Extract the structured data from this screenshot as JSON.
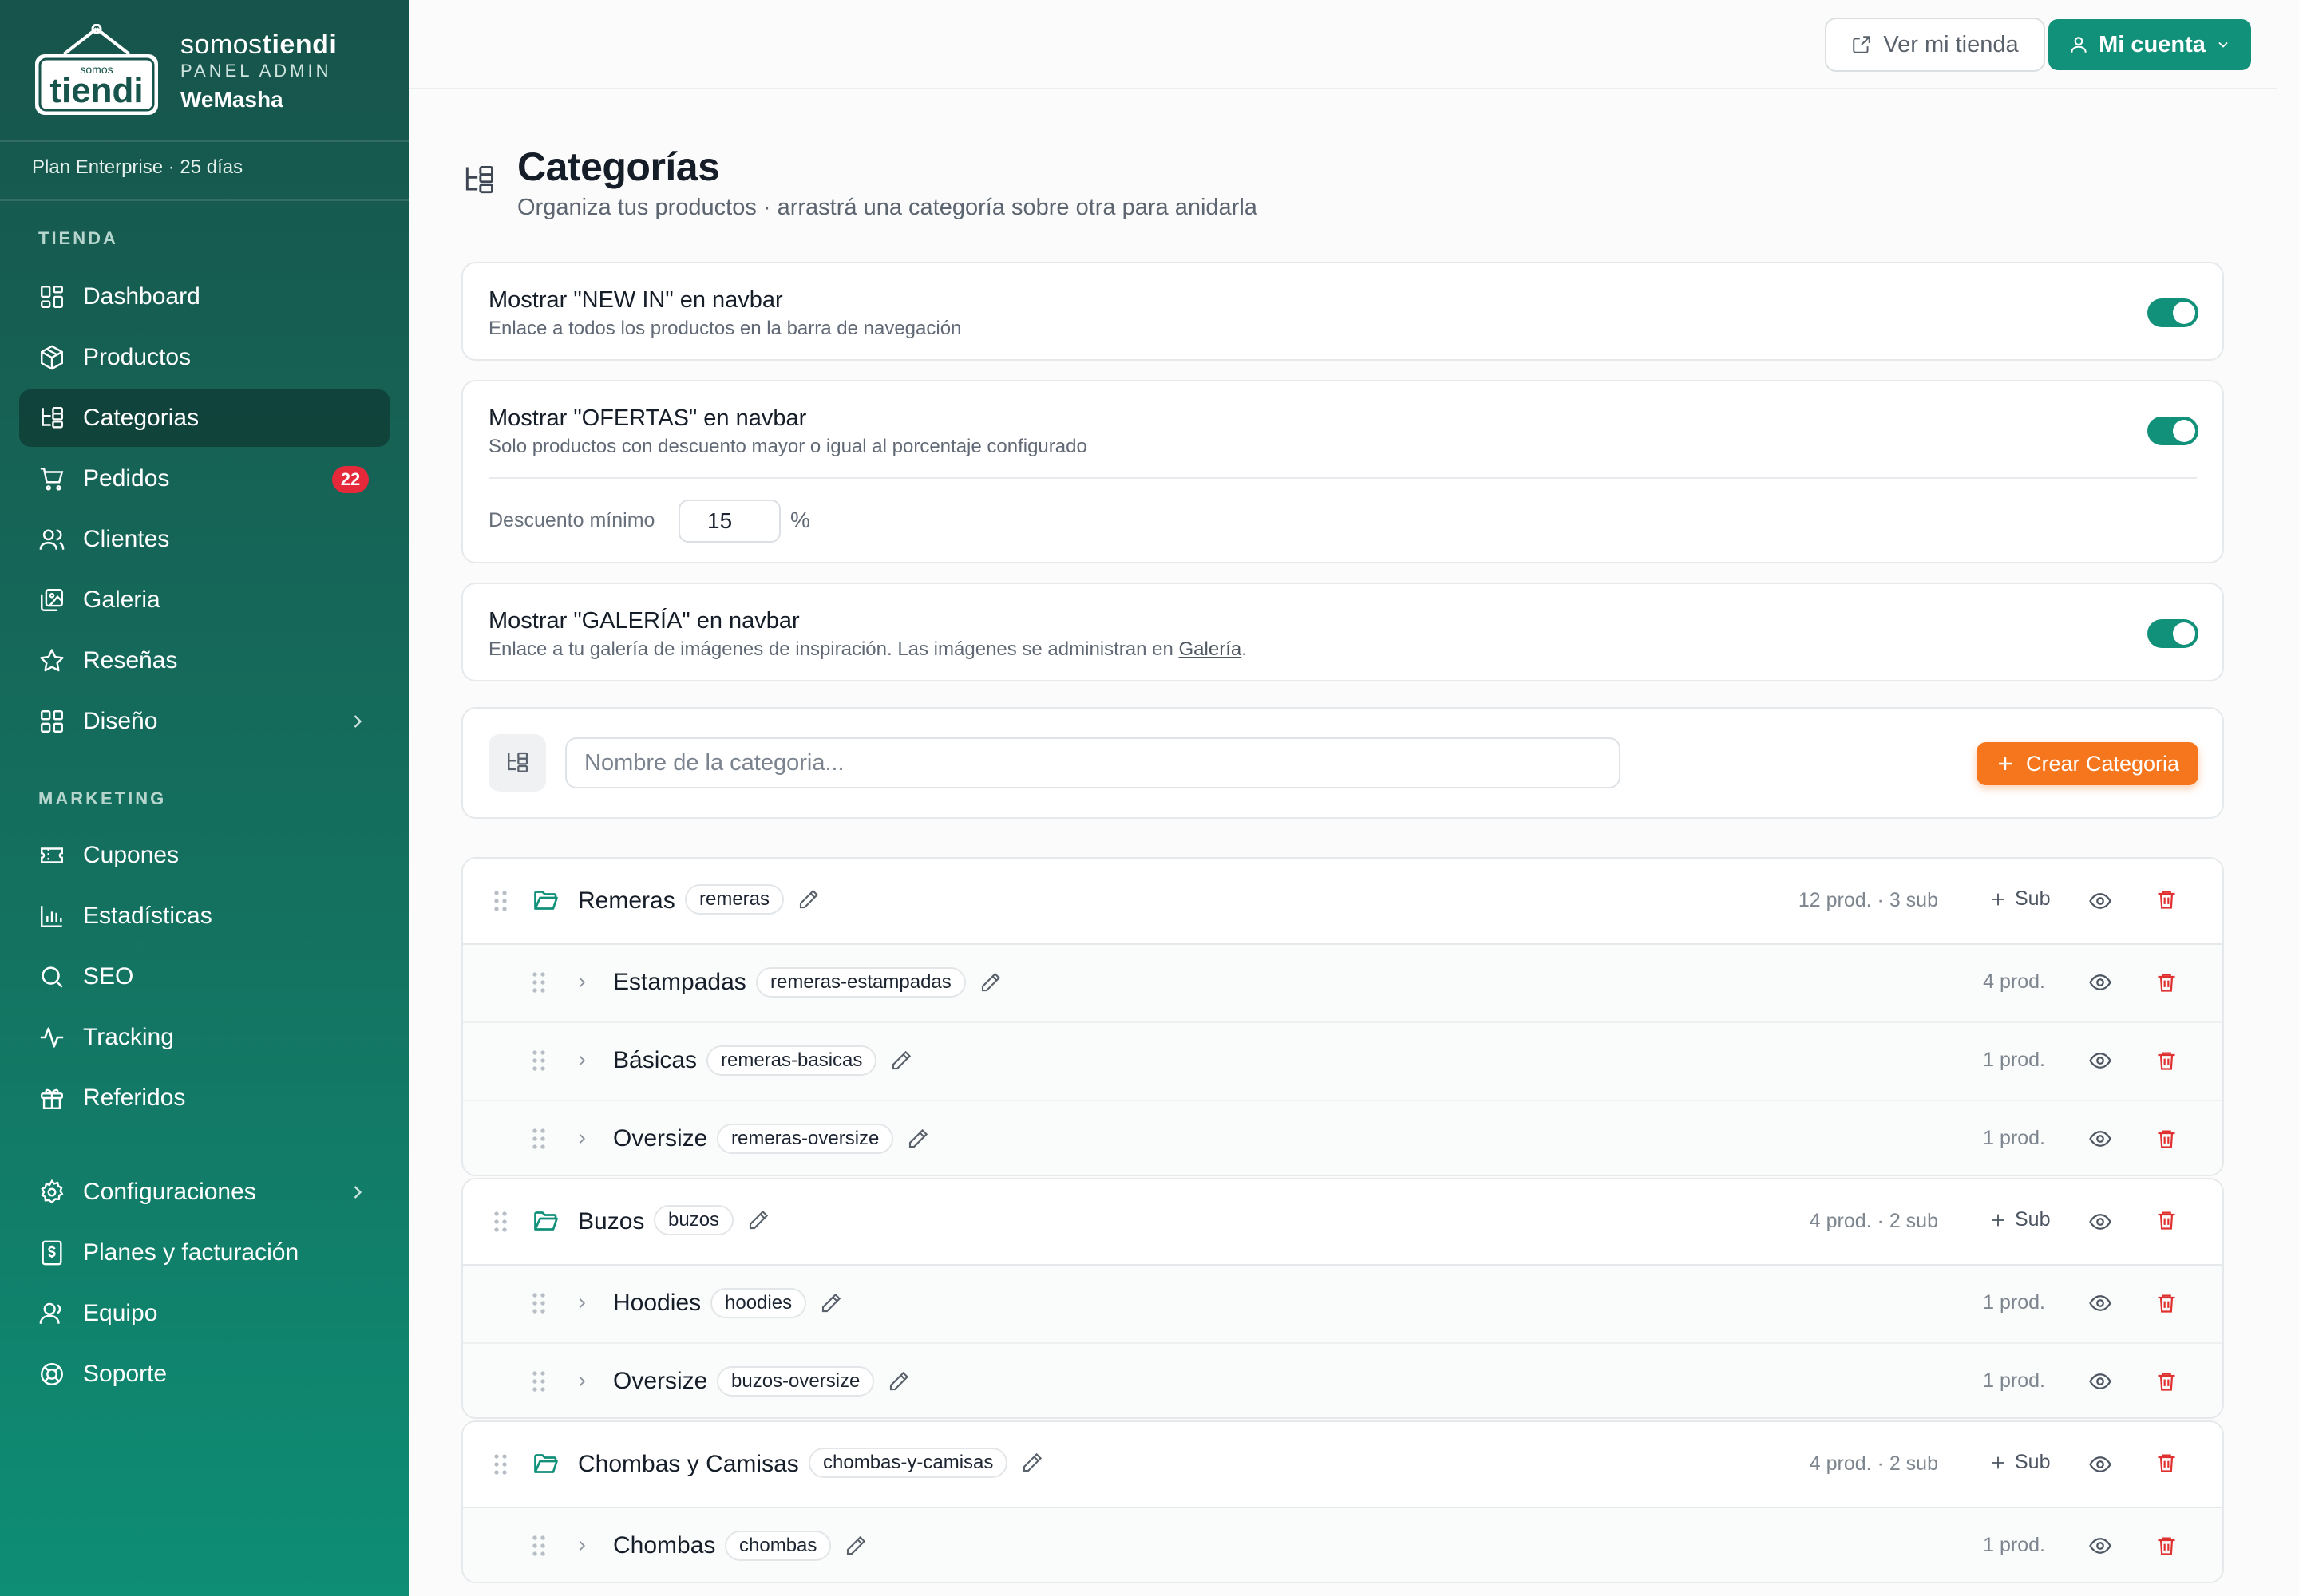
{
  "brand": {
    "name_light": "somos",
    "name_bold": "tiendi",
    "panel_label": "PANEL ADMIN",
    "store_name": "WeMasha",
    "logo_small": "somos",
    "logo_big": "tiendi"
  },
  "plan": "Plan Enterprise · 25 días",
  "sidebar": {
    "section_store": "TIENDA",
    "section_marketing": "MARKETING",
    "items": [
      {
        "label": "Dashboard",
        "icon": "grid-icon"
      },
      {
        "label": "Productos",
        "icon": "box-icon"
      },
      {
        "label": "Categorias",
        "icon": "tree-icon",
        "active": true
      },
      {
        "label": "Pedidos",
        "icon": "cart-icon",
        "badge": "22"
      },
      {
        "label": "Clientes",
        "icon": "users-icon"
      },
      {
        "label": "Galeria",
        "icon": "images-icon"
      },
      {
        "label": "Reseñas",
        "icon": "star-icon"
      },
      {
        "label": "Diseño",
        "icon": "layout-icon",
        "chevron": true
      },
      {
        "label": "Cupones",
        "icon": "ticket-icon"
      },
      {
        "label": "Estadísticas",
        "icon": "bar-chart-icon"
      },
      {
        "label": "SEO",
        "icon": "search-icon"
      },
      {
        "label": "Tracking",
        "icon": "activity-icon"
      },
      {
        "label": "Referidos",
        "icon": "gift-icon"
      },
      {
        "label": "Configuraciones",
        "icon": "gear-icon",
        "chevron": true
      },
      {
        "label": "Planes y facturación",
        "icon": "receipt-icon"
      },
      {
        "label": "Equipo",
        "icon": "user-icon"
      },
      {
        "label": "Soporte",
        "icon": "lifebuoy-icon"
      }
    ]
  },
  "topbar": {
    "view_store": "Ver mi tienda",
    "account": "Mi cuenta"
  },
  "page": {
    "title": "Categorías",
    "subtitle": "Organiza tus productos · arrastrá una categoría sobre otra para anidarla"
  },
  "settings": {
    "new_in": {
      "title": "Mostrar \"NEW IN\" en navbar",
      "desc": "Enlace a todos los productos en la barra de navegación",
      "enabled": true
    },
    "ofertas": {
      "title": "Mostrar \"OFERTAS\" en navbar",
      "desc": "Solo productos con descuento mayor o igual al porcentaje configurado",
      "enabled": true,
      "discount_label": "Descuento mínimo",
      "discount_value": "15",
      "discount_unit": "%"
    },
    "galeria": {
      "title": "Mostrar \"GALERÍA\" en navbar",
      "desc_prefix": "Enlace a tu galería de imágenes de inspiración. Las imágenes se administran en ",
      "desc_link": "Galería",
      "desc_suffix": ".",
      "enabled": true
    }
  },
  "create": {
    "placeholder": "Nombre de la categoria...",
    "button": "Crear Categoria"
  },
  "categories": [
    {
      "name": "Remeras",
      "slug": "remeras",
      "meta": "12 prod. · 3 sub",
      "sub_label": "Sub",
      "children": [
        {
          "name": "Estampadas",
          "slug": "remeras-estampadas",
          "meta": "4 prod."
        },
        {
          "name": "Básicas",
          "slug": "remeras-basicas",
          "meta": "1 prod."
        },
        {
          "name": "Oversize",
          "slug": "remeras-oversize",
          "meta": "1 prod."
        }
      ]
    },
    {
      "name": "Buzos",
      "slug": "buzos",
      "meta": "4 prod. · 2 sub",
      "sub_label": "Sub",
      "children": [
        {
          "name": "Hoodies",
          "slug": "hoodies",
          "meta": "1 prod."
        },
        {
          "name": "Oversize",
          "slug": "buzos-oversize",
          "meta": "1 prod."
        }
      ]
    },
    {
      "name": "Chombas y Camisas",
      "slug": "chombas-y-camisas",
      "meta": "4 prod. · 2 sub",
      "sub_label": "Sub",
      "children": [
        {
          "name": "Chombas",
          "slug": "chombas",
          "meta": "1 prod."
        }
      ]
    }
  ],
  "colors": {
    "accent": "#11907a",
    "sidebar_top": "#17544b",
    "sidebar_bottom": "#0e8e75",
    "create_button": "#f5761c",
    "danger": "#e03131",
    "badge": "#e5293b"
  }
}
